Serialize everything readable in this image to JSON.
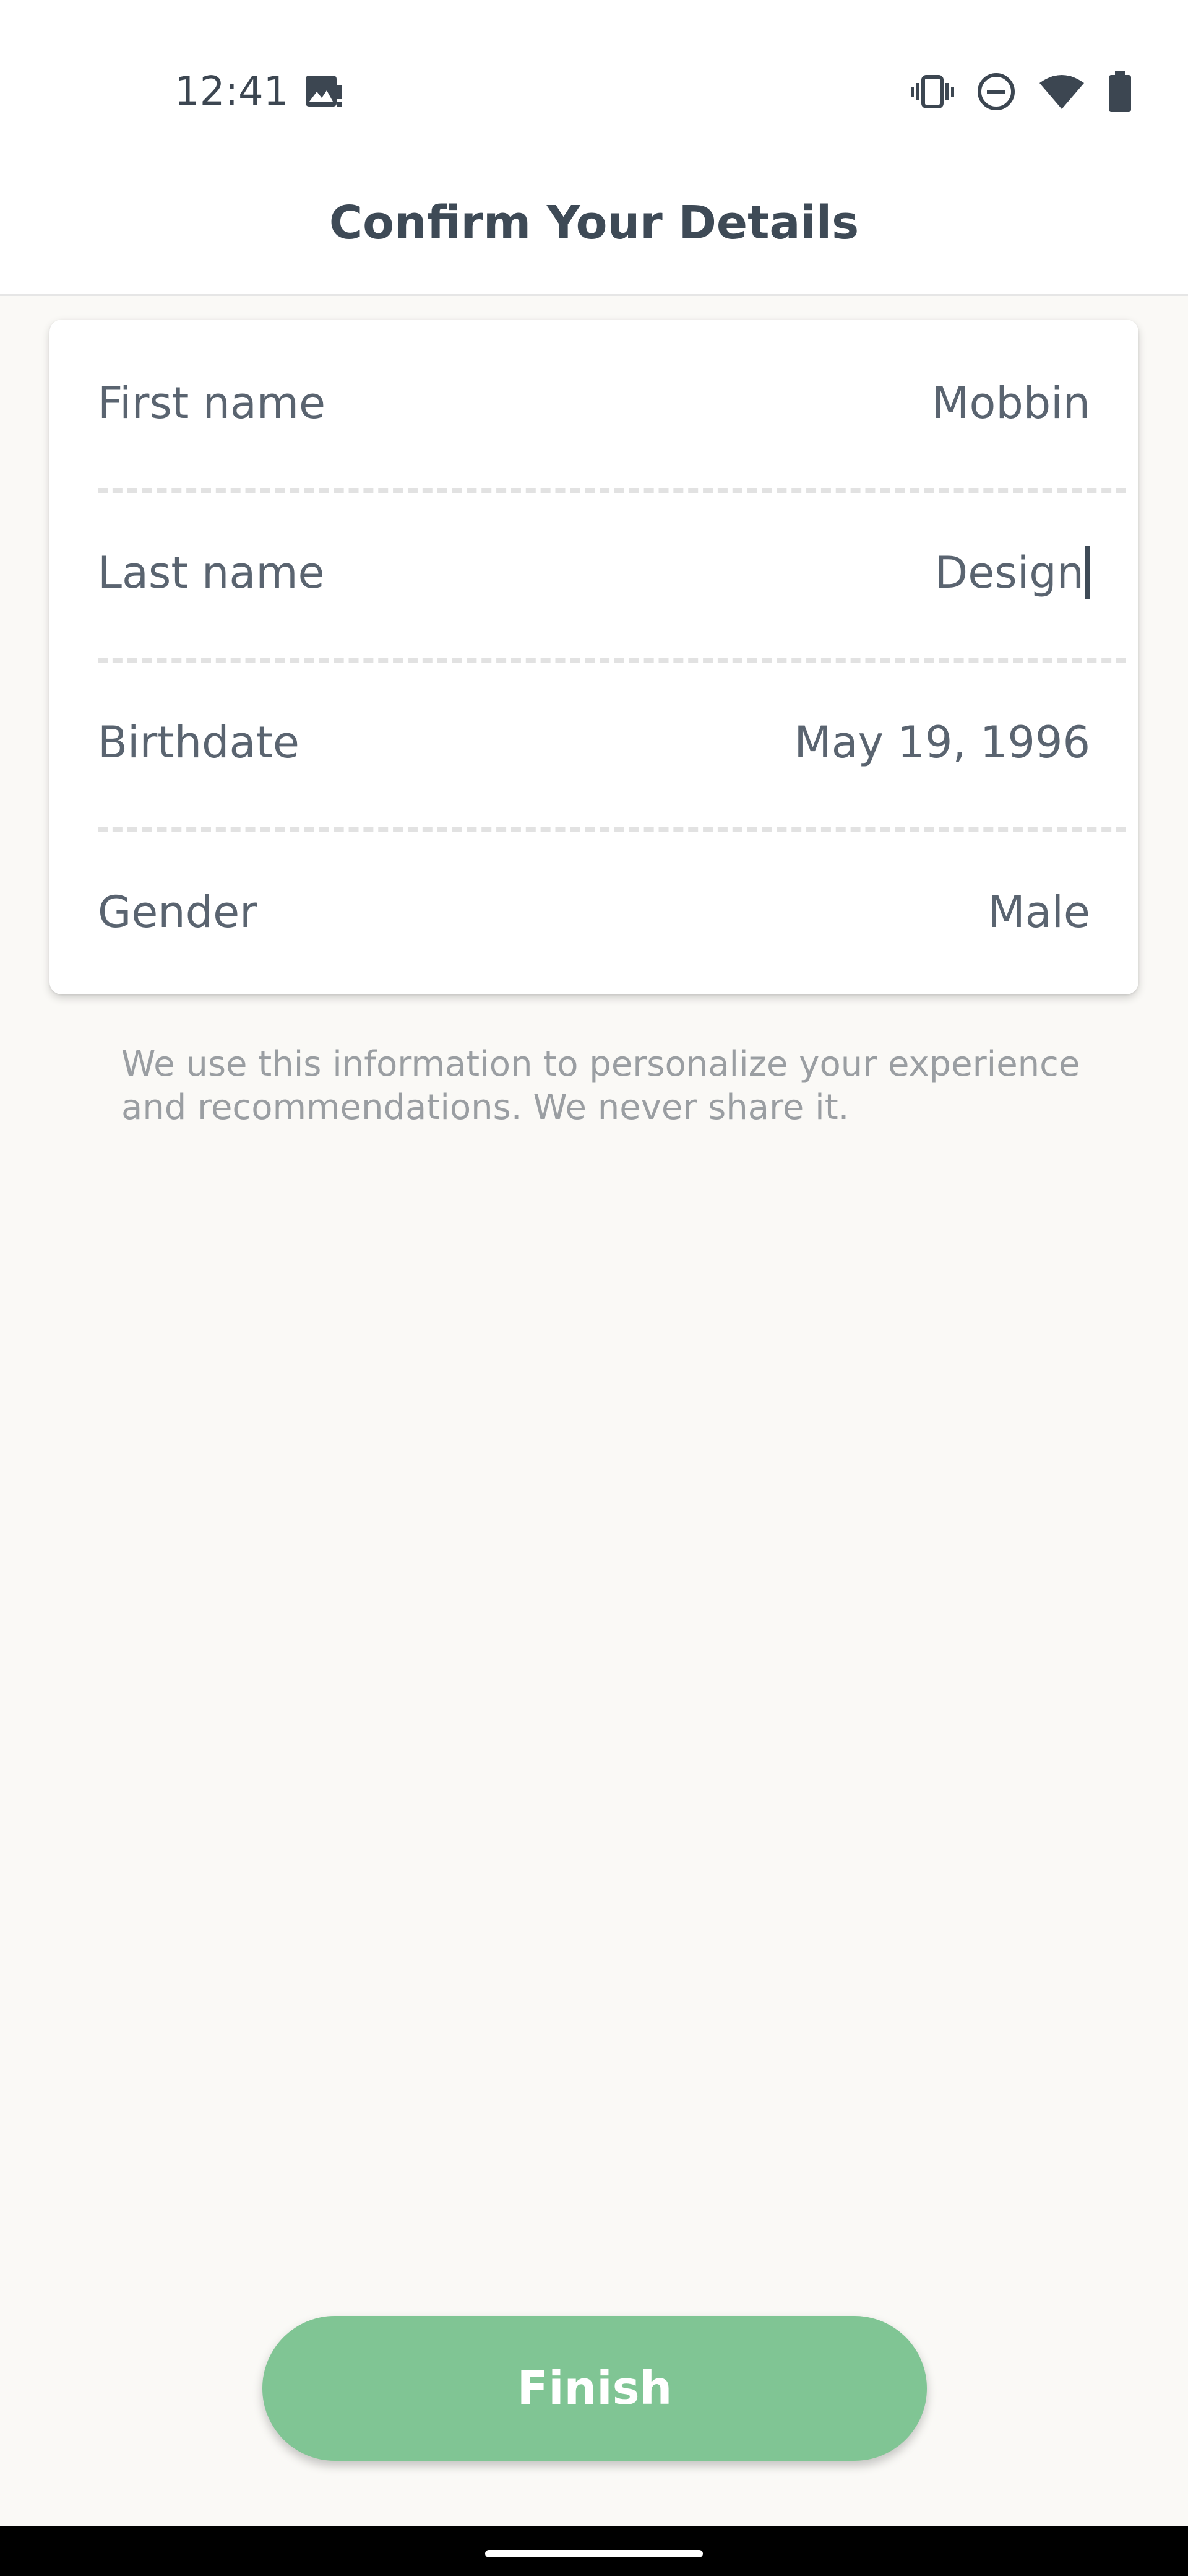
{
  "status_bar": {
    "time": "12:41",
    "icons": [
      "photo-notification-icon",
      "vibrate-icon",
      "do-not-disturb-icon",
      "wifi-icon",
      "battery-icon"
    ]
  },
  "header": {
    "title": "Confirm Your Details"
  },
  "details": {
    "fields": [
      {
        "label": "First name",
        "value": "Mobbin"
      },
      {
        "label": "Last name",
        "value": "Design"
      },
      {
        "label": "Birthdate",
        "value": "May 19, 1996"
      },
      {
        "label": "Gender",
        "value": "Male"
      }
    ]
  },
  "info": {
    "text": "We use this information to personalize your experience and recommendations. We never share it."
  },
  "actions": {
    "finish_label": "Finish"
  },
  "colors": {
    "accent": "#80C594",
    "background": "#FAF9F6",
    "text": "#4A5561"
  }
}
